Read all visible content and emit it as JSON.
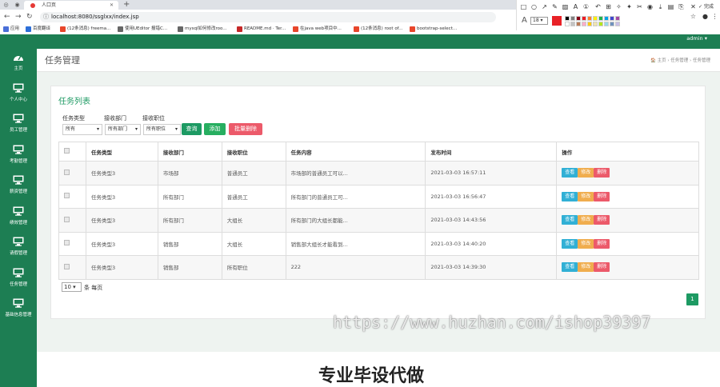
{
  "browser": {
    "tab_title": "人口页",
    "url": "localhost:8080/ssglxx/index.jsp",
    "bookmarks": [
      {
        "label": "应用",
        "color": "#4a6fd8"
      },
      {
        "label": "百度翻译",
        "color": "#2d6fd8"
      },
      {
        "label": "(12条消息) freema...",
        "color": "#e8462b"
      },
      {
        "label": "使用UEditor 报错C...",
        "color": "#666666"
      },
      {
        "label": "mysql如何修改roo...",
        "color": "#666666"
      },
      {
        "label": "README.md · Ter...",
        "color": "#c62828"
      },
      {
        "label": "在java web项目中...",
        "color": "#e8462b"
      },
      {
        "label": "(12条消息) root of...",
        "color": "#e8462b"
      },
      {
        "label": "bootstrap-select...",
        "color": "#e8462b"
      }
    ]
  },
  "snip_toolbar": {
    "done_label": "完成",
    "font_letter": "A",
    "font_size": "18",
    "current_color": "#e82127",
    "swatches": [
      "#000000",
      "#7f7f7f",
      "#880015",
      "#ed1c24",
      "#ff7f27",
      "#fff200",
      "#22b14c",
      "#00a2e8",
      "#3f48cc",
      "#a349a4",
      "#ffffff",
      "#c3c3c3",
      "#b97a57",
      "#ffaec9",
      "#ffc90e",
      "#efe4b0",
      "#b5e61d",
      "#99d9ea",
      "#7092be",
      "#c8bfe7"
    ]
  },
  "app": {
    "logo": "",
    "user": "admin ▾",
    "sidebar": [
      {
        "label": "主页",
        "icon": "dashboard-icon"
      },
      {
        "label": "个人中心",
        "icon": "monitor-icon"
      },
      {
        "label": "员工管理",
        "icon": "monitor-icon"
      },
      {
        "label": "考勤管理",
        "icon": "monitor-icon"
      },
      {
        "label": "薪资管理",
        "icon": "monitor-icon"
      },
      {
        "label": "绩效管理",
        "icon": "monitor-icon"
      },
      {
        "label": "请假管理",
        "icon": "monitor-icon"
      },
      {
        "label": "任务管理",
        "icon": "monitor-icon"
      },
      {
        "label": "基础信息管理",
        "icon": "monitor-icon"
      }
    ],
    "page_title": "任务管理",
    "breadcrumb": "🏠 主页  ›  任务管理  ›  任务管理",
    "panel_title": "任务列表",
    "filters": {
      "labels": [
        "任务类型",
        "接收部门",
        "接收职位"
      ],
      "selects": [
        "所有",
        "所有部门",
        "所有职位"
      ],
      "query_btn": "查询",
      "add_btn": "添加",
      "batch_delete_btn": "批量删除"
    },
    "table": {
      "headers": [
        "",
        "任务类型",
        "接收部门",
        "接收职位",
        "任务内容",
        "发布时间",
        "操作"
      ],
      "rows": [
        [
          "任务类型3",
          "市场部",
          "普通员工",
          "市场部的普通员工可以...",
          "2021-03-03 16:57:11"
        ],
        [
          "任务类型3",
          "所有部门",
          "普通员工",
          "所有部门的普通员工可...",
          "2021-03-03 16:56:47"
        ],
        [
          "任务类型3",
          "所有部门",
          "大组长",
          "所有部门的大组长都能...",
          "2021-03-03 14:43:56"
        ],
        [
          "任务类型3",
          "销售部",
          "大组长",
          "销售部大组长才能看到...",
          "2021-03-03 14:40:20"
        ],
        [
          "任务类型3",
          "销售部",
          "所有职位",
          "222",
          "2021-03-03 14:39:30"
        ]
      ],
      "actions": {
        "view": "查看",
        "edit": "修改",
        "delete": "删除"
      }
    },
    "pagination": {
      "page_size": "10",
      "page_size_suffix": "条 每页",
      "current_page": "1"
    }
  },
  "watermark": {
    "url": "https://www.huzhan.com/ishop39397",
    "slogan": "专业毕设代做"
  },
  "colors": {
    "brand_green": "#1d7e53",
    "accent_green": "#1d9a63",
    "info": "#31b0d5",
    "warning": "#f0ad4e",
    "danger": "#ec5a6a"
  }
}
